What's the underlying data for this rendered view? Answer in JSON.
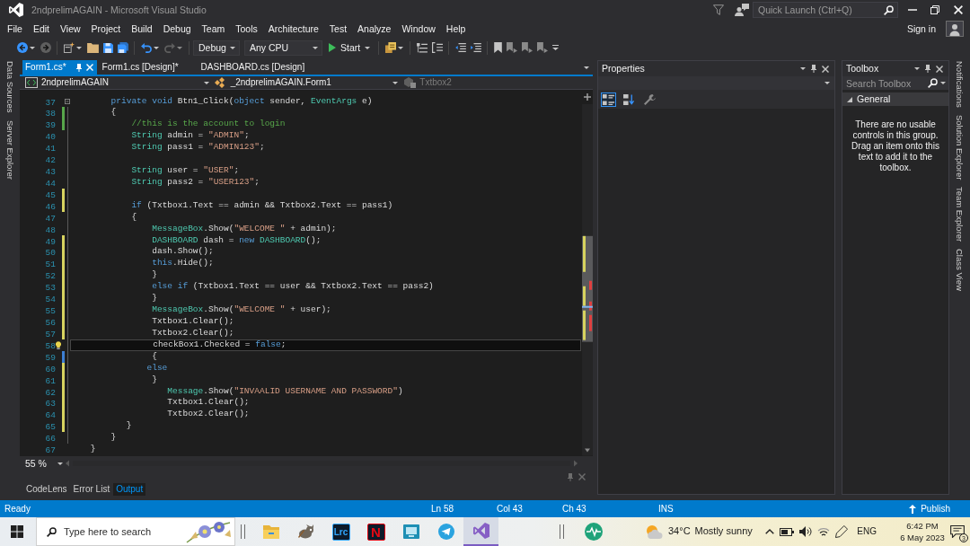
{
  "window": {
    "title": "2ndprelimAGAIN - Microsoft Visual Studio"
  },
  "quick_launch": {
    "placeholder": "Quick Launch (Ctrl+Q)"
  },
  "menu": [
    "File",
    "Edit",
    "View",
    "Project",
    "Build",
    "Debug",
    "Team",
    "Tools",
    "Architecture",
    "Test",
    "Analyze",
    "Window",
    "Help"
  ],
  "account": {
    "label": "Sign in"
  },
  "toolbar": {
    "left_buttons": [
      {
        "disabled": false
      },
      {
        "disabled": true
      },
      {
        "disabled": false
      },
      {
        "disabled": false
      },
      {
        "disabled": false
      },
      {
        "disabled": false
      },
      {
        "disabled": false
      },
      {
        "disabled": true
      }
    ],
    "configuration": "Debug",
    "platform": "Any CPU",
    "start": "Start",
    "right_buttons": [
      {
        "disabled": false
      },
      {
        "disabled": false
      },
      {
        "disabled": false
      },
      {
        "disabled": false
      },
      {
        "disabled": false
      },
      {
        "disabled": false
      },
      {
        "disabled": true
      },
      {
        "disabled": true
      },
      {
        "disabled": true
      }
    ]
  },
  "left_strip": [
    {
      "label": "Data Sources"
    },
    {
      "label": "Server Explorer"
    }
  ],
  "editor": {
    "tabs": [
      {
        "label": "Form1.cs*",
        "selected": true
      },
      {
        "label": "Form1.cs [Design]*",
        "selected": false
      },
      {
        "label": "DASHBOARD.cs [Design]",
        "selected": false
      }
    ],
    "navigation": [
      {
        "kind": "project",
        "label": "2ndprelimAGAIN",
        "disabled": false
      },
      {
        "kind": "class",
        "label": "_2ndprelimAGAIN.Form1",
        "disabled": false
      },
      {
        "kind": "member",
        "label": "Txtbox2",
        "disabled": true
      }
    ],
    "lines": [
      {
        "number": "37",
        "current": false,
        "fold": {
          "expanded": true
        },
        "tokens": [
          {
            "kind": "keyword",
            "text": "        private void"
          },
          {
            "kind": "plain",
            "text": " Btn1_Click("
          },
          {
            "kind": "keyword",
            "text": "object"
          },
          {
            "kind": "plain",
            "text": " sender, "
          },
          {
            "kind": "type",
            "text": "EventArgs"
          },
          {
            "kind": "plain",
            "text": " e)"
          }
        ]
      },
      {
        "number": "38",
        "current": false,
        "change": {
          "color": "#57a64a"
        },
        "tokens": [
          {
            "kind": "plain",
            "text": "        {"
          }
        ]
      },
      {
        "number": "39",
        "current": false,
        "change": {
          "color": "#57a64a"
        },
        "tokens": [
          {
            "kind": "comment",
            "text": "            //this is the account to login"
          }
        ]
      },
      {
        "number": "40",
        "current": false,
        "tokens": [
          {
            "kind": "type",
            "text": "            String"
          },
          {
            "kind": "plain",
            "text": " admin = "
          },
          {
            "kind": "string",
            "text": "\"ADMIN\""
          },
          {
            "kind": "plain",
            "text": ";"
          }
        ]
      },
      {
        "number": "41",
        "current": false,
        "tokens": [
          {
            "kind": "type",
            "text": "            String"
          },
          {
            "kind": "plain",
            "text": " pass1 = "
          },
          {
            "kind": "string",
            "text": "\"ADMIN123\""
          },
          {
            "kind": "plain",
            "text": ";"
          }
        ]
      },
      {
        "number": "42",
        "current": false
      },
      {
        "number": "43",
        "current": false,
        "tokens": [
          {
            "kind": "type",
            "text": "            String"
          },
          {
            "kind": "plain",
            "text": " user = "
          },
          {
            "kind": "string",
            "text": "\"USER\""
          },
          {
            "kind": "plain",
            "text": ";"
          }
        ]
      },
      {
        "number": "44",
        "current": false,
        "tokens": [
          {
            "kind": "type",
            "text": "            String"
          },
          {
            "kind": "plain",
            "text": " pass2 = "
          },
          {
            "kind": "string",
            "text": "\"USER123\""
          },
          {
            "kind": "plain",
            "text": ";"
          }
        ]
      },
      {
        "number": "45",
        "current": false,
        "change": {
          "color": "#d7d35f"
        }
      },
      {
        "number": "46",
        "current": false,
        "change": {
          "color": "#d7d35f"
        },
        "tokens": [
          {
            "kind": "keyword",
            "text": "            if"
          },
          {
            "kind": "plain",
            "text": " (Txtbox1.Text == admin && Txtbox2.Text == pass1)"
          }
        ]
      },
      {
        "number": "47",
        "current": false,
        "tokens": [
          {
            "kind": "plain",
            "text": "            {"
          }
        ]
      },
      {
        "number": "48",
        "current": false,
        "tokens": [
          {
            "kind": "type",
            "text": "                MessageBox"
          },
          {
            "kind": "plain",
            "text": ".Show("
          },
          {
            "kind": "string",
            "text": "\"WELCOME \""
          },
          {
            "kind": "plain",
            "text": " + admin);"
          }
        ]
      },
      {
        "number": "49",
        "current": false,
        "change": {
          "color": "#d7d35f"
        },
        "tokens": [
          {
            "kind": "type",
            "text": "                DASHBOARD"
          },
          {
            "kind": "plain",
            "text": " dash = "
          },
          {
            "kind": "keyword",
            "text": "new"
          },
          {
            "kind": "type",
            "text": " DASHBOARD"
          },
          {
            "kind": "plain",
            "text": "();"
          }
        ]
      },
      {
        "number": "50",
        "current": false,
        "change": {
          "color": "#d7d35f"
        },
        "tokens": [
          {
            "kind": "plain",
            "text": "                dash.Show();"
          }
        ]
      },
      {
        "number": "51",
        "current": false,
        "change": {
          "color": "#d7d35f"
        },
        "tokens": [
          {
            "kind": "keyword",
            "text": "                this"
          },
          {
            "kind": "plain",
            "text": ".Hide();"
          }
        ]
      },
      {
        "number": "52",
        "current": false,
        "change": {
          "color": "#d7d35f"
        },
        "tokens": [
          {
            "kind": "plain",
            "text": "                }"
          }
        ]
      },
      {
        "number": "53",
        "current": false,
        "change": {
          "color": "#d7d35f"
        },
        "tokens": [
          {
            "kind": "keyword",
            "text": "                else if"
          },
          {
            "kind": "plain",
            "text": " (Txtbox1.Text == user && Txtbox2.Text == pass2)"
          }
        ]
      },
      {
        "number": "54",
        "current": false,
        "change": {
          "color": "#d7d35f"
        },
        "tokens": [
          {
            "kind": "plain",
            "text": "                }"
          }
        ]
      },
      {
        "number": "55",
        "current": false,
        "change": {
          "color": "#d7d35f"
        },
        "tokens": [
          {
            "kind": "type",
            "text": "                MessageBox"
          },
          {
            "kind": "plain",
            "text": ".Show("
          },
          {
            "kind": "string",
            "text": "\"WELCOME \""
          },
          {
            "kind": "plain",
            "text": " + user);"
          }
        ]
      },
      {
        "number": "56",
        "current": false,
        "change": {
          "color": "#d7d35f"
        },
        "tokens": [
          {
            "kind": "plain",
            "text": "                Txtbox1.Clear();"
          }
        ]
      },
      {
        "number": "57",
        "current": false,
        "change": {
          "color": "#d7d35f"
        },
        "tokens": [
          {
            "kind": "plain",
            "text": "                Txtbox2.Clear();"
          }
        ]
      },
      {
        "number": "58",
        "current": true,
        "lightbulb": true,
        "tokens": [
          {
            "kind": "plain",
            "text": "                checkBox1.Checked = "
          },
          {
            "kind": "keyword",
            "text": "false"
          },
          {
            "kind": "plain",
            "text": ";"
          }
        ]
      },
      {
        "number": "59",
        "current": false,
        "change": {
          "color": "#3d7fd4"
        },
        "tokens": [
          {
            "kind": "plain",
            "text": "                {"
          }
        ]
      },
      {
        "number": "60",
        "current": false,
        "change": {
          "color": "#d7d35f"
        },
        "tokens": [
          {
            "kind": "keyword",
            "text": "               else"
          }
        ]
      },
      {
        "number": "61",
        "current": false,
        "change": {
          "color": "#d7d35f"
        },
        "tokens": [
          {
            "kind": "plain",
            "text": "                }"
          }
        ]
      },
      {
        "number": "62",
        "current": false,
        "change": {
          "color": "#d7d35f"
        },
        "tokens": [
          {
            "kind": "type",
            "text": "                   Message"
          },
          {
            "kind": "plain",
            "text": ".Show("
          },
          {
            "kind": "string",
            "text": "\"INVAALID USERNAME AND PASSWORD\""
          },
          {
            "kind": "plain",
            "text": ")"
          }
        ]
      },
      {
        "number": "63",
        "current": false,
        "change": {
          "color": "#d7d35f"
        },
        "tokens": [
          {
            "kind": "plain",
            "text": "                   Txtbox1.Clear();"
          }
        ]
      },
      {
        "number": "64",
        "current": false,
        "change": {
          "color": "#d7d35f"
        },
        "tokens": [
          {
            "kind": "plain",
            "text": "                   Txtbox2.Clear();"
          }
        ]
      },
      {
        "number": "65",
        "current": false,
        "change": {
          "color": "#d7d35f"
        },
        "tokens": [
          {
            "kind": "plain",
            "text": "           }"
          }
        ]
      },
      {
        "number": "66",
        "current": false,
        "tokens": [
          {
            "kind": "plain",
            "text": "        }"
          }
        ]
      },
      {
        "number": "67",
        "current": false,
        "tokens": [
          {
            "kind": "plain",
            "text": "    }"
          }
        ]
      }
    ],
    "zoom": "55 %",
    "panel_tabs": [
      {
        "label": "CodeLens",
        "selected": false
      },
      {
        "label": "Error List",
        "selected": false
      },
      {
        "label": "Output",
        "selected": true
      }
    ]
  },
  "properties": {
    "title": "Properties",
    "view_buttons": [
      {
        "selected": true,
        "disabled": false
      },
      {
        "selected": false,
        "disabled": false
      },
      {
        "selected": false,
        "disabled": true
      }
    ]
  },
  "toolbox": {
    "title": "Toolbox",
    "search": {
      "placeholder": "Search Toolbox"
    },
    "groups": [
      {
        "label": "General",
        "expanded": true,
        "message": "There are no usable controls in this group. Drag an item onto this text to add it to the toolbox."
      }
    ]
  },
  "right_strip": [
    {
      "label": "Notifications"
    },
    {
      "label": "Solution Explorer"
    },
    {
      "label": "Team Explorer"
    },
    {
      "label": "Class View"
    }
  ],
  "status_bar": {
    "message": "Ready",
    "line": "Ln 58",
    "column": "Col 43",
    "character": "Ch 43",
    "mode": "INS",
    "publish": "Publish"
  },
  "taskbar": {
    "search": {
      "placeholder": "Type here to search"
    },
    "apps": [
      {
        "kind": "folder",
        "active": false
      },
      {
        "kind": "mascot",
        "active": false
      },
      {
        "kind": "tile",
        "label": "Lrc",
        "color": "#31a8ff",
        "active": false
      },
      {
        "kind": "tile",
        "label": "N",
        "color": "#e50914",
        "active": false
      },
      {
        "kind": "monitor",
        "active": false
      },
      {
        "kind": "plane",
        "active": false
      },
      {
        "kind": "studio",
        "active": true
      }
    ],
    "other_apps": [
      {
        "kind": "pulse",
        "active": false
      }
    ],
    "weather": {
      "temperature": "34°C",
      "condition": "Mostly sunny"
    },
    "language": "ENG",
    "time": "6:42 PM",
    "date": "6 May 2023",
    "notifications": "3"
  }
}
